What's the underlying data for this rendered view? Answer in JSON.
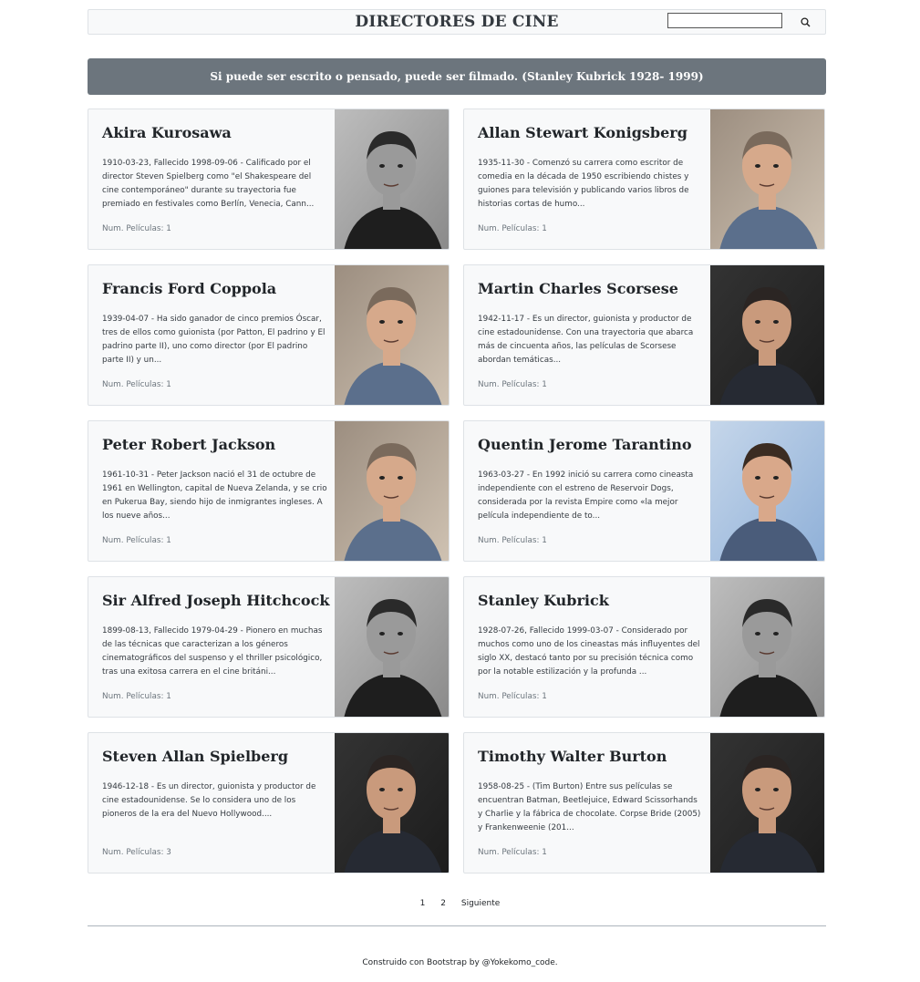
{
  "header": {
    "title": "DIRECTORES DE CINE",
    "search_value": "",
    "search_icon": "search-icon"
  },
  "quote": "Si puede ser escrito o pensado, puede ser filmado. (Stanley Kubrick 1928- 1999)",
  "directors": [
    {
      "name": "Akira Kurosawa",
      "description": "1910-03-23, Fallecido 1998-09-06 - Calificado por el director Steven Spielberg como \"el Shakespeare del cine contemporáneo\" durante su trayectoria fue premiado en festivales como Berlín, Venecia, Cann...",
      "count": "Num. Películas: 1",
      "photo": "bw"
    },
    {
      "name": "Allan Stewart Konigsberg",
      "description": "1935-11-30 - Comenzó su carrera como escritor de comedia en la década de 1950 escribiendo chistes y guiones para televisión y publicando varios libros de historias cortas de humo...",
      "count": "Num. Películas: 1",
      "photo": "color"
    },
    {
      "name": "Francis Ford Coppola",
      "description": "1939-04-07 - Ha sido ganador de cinco premios Óscar, tres de ellos como guionista (por Patton, El padrino y El padrino parte II), uno como director (por El padrino parte II) y un...",
      "count": "Num. Películas: 1",
      "photo": "color"
    },
    {
      "name": "Martin Charles Scorsese",
      "description": "1942-11-17 - Es un director, guionista y productor de cine estadounidense. Con una trayectoria que abarca más de cincuenta años, las películas de Scorsese abordan temáticas...",
      "count": "Num. Películas: 1",
      "photo": "dark"
    },
    {
      "name": "Peter Robert Jackson",
      "description": "1961-10-31 - Peter Jackson nació el 31 de octubre de 1961 en Wellington, capital de Nueva Zelanda, y se crio en Pukerua Bay, siendo hijo de inmigrantes ingleses. A los nueve años...",
      "count": "Num. Películas: 1",
      "photo": "color"
    },
    {
      "name": "Quentin Jerome Tarantino",
      "description": "1963-03-27 - En 1992 inició su carrera como cineasta independiente con el estreno de Reservoir Dogs, considerada por la revista Empire como «la mejor película independiente de to...",
      "count": "Num. Películas: 1",
      "photo": "blue"
    },
    {
      "name": "Sir Alfred Joseph Hitchcock",
      "description": "1899-08-13, Fallecido 1979-04-29 - Pionero en muchas de las técnicas que caracterizan a los géneros cinematográficos del suspenso y el thriller psicológico, tras una exitosa carrera en el cine británi...",
      "count": "Num. Películas: 1",
      "photo": "bw"
    },
    {
      "name": "Stanley Kubrick",
      "description": "1928-07-26, Fallecido 1999-03-07 - Considerado por muchos como uno de los cineastas más influyentes del siglo XX, destacó tanto por su precisión técnica como por la notable estilización y la profunda ...",
      "count": "Num. Películas: 1",
      "photo": "bw"
    },
    {
      "name": "Steven Allan Spielberg",
      "description": "1946-12-18 - Es un director, guionista y productor de cine estadounidense. Se lo considera uno de los pioneros de la era del Nuevo Hollywood....",
      "count": "Num. Películas: 3",
      "photo": "dark"
    },
    {
      "name": "Timothy Walter Burton",
      "description": "1958-08-25 - (Tim Burton) Entre sus películas se encuentran Batman, Beetlejuice, Edward Scissorhands y Charlie y la fábrica de chocolate. Corpse Bride (2005) y Frankenweenie (201...",
      "count": "Num. Películas: 1",
      "photo": "dark"
    }
  ],
  "pagination": {
    "page1": "1",
    "page2": "2",
    "next": "Siguiente"
  },
  "footer": "Construido con Bootstrap by @Yokekomo_code."
}
